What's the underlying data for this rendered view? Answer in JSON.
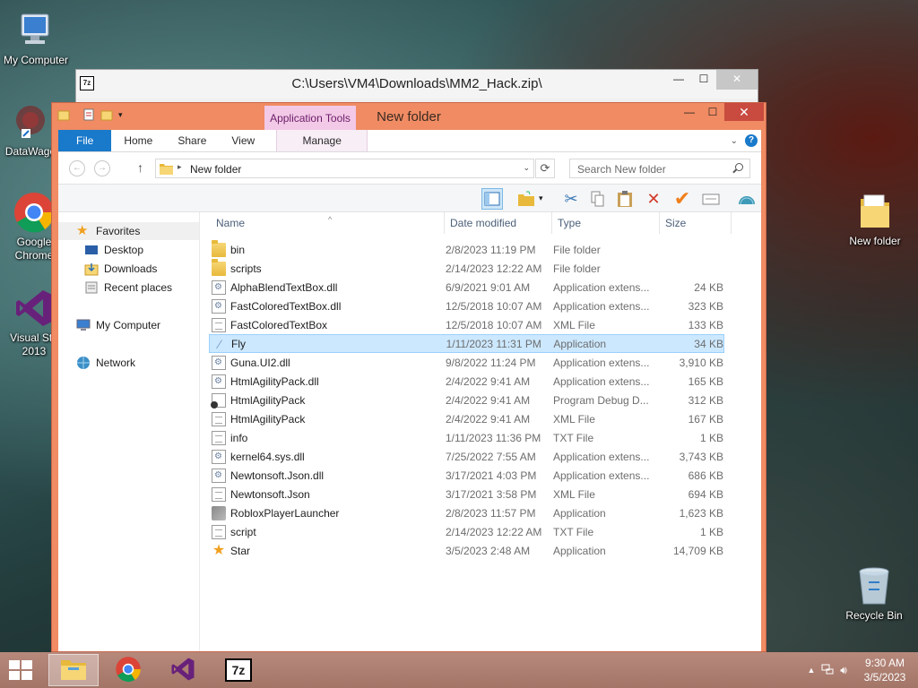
{
  "desktop": {
    "icons": [
      {
        "label": "My Computer"
      },
      {
        "label": "DataWago"
      },
      {
        "label_1": "Google",
        "label_2": "Chrome"
      },
      {
        "label_1": "Visual Stu",
        "label_2": "2013"
      },
      {
        "label": "New folder"
      },
      {
        "label": "Recycle Bin"
      }
    ]
  },
  "zip_window": {
    "title": "C:\\Users\\VM4\\Downloads\\MM2_Hack.zip\\",
    "app_icon": "7z",
    "controls": {
      "minimize": "—",
      "maximize": "☐",
      "close": "✕"
    }
  },
  "explorer": {
    "title": "New folder",
    "contextual_tab_group": "Application Tools",
    "controls": {
      "minimize": "—",
      "maximize": "☐",
      "close": "✕"
    },
    "ribbon_tabs": [
      "File",
      "Home",
      "Share",
      "View",
      "Manage"
    ],
    "address": {
      "path": "New folder"
    },
    "search": {
      "placeholder": "Search New folder"
    },
    "sidebar": {
      "favorites": "Favorites",
      "desktop": "Desktop",
      "downloads": "Downloads",
      "recent": "Recent places",
      "computer": "My Computer",
      "network": "Network"
    },
    "columns": {
      "name": "Name",
      "date": "Date modified",
      "type": "Type",
      "size": "Size"
    },
    "files": [
      {
        "name": "bin",
        "date": "2/8/2023 11:19 PM",
        "type": "File folder",
        "size": "",
        "icon": "folder-icon"
      },
      {
        "name": "scripts",
        "date": "2/14/2023 12:22 AM",
        "type": "File folder",
        "size": "",
        "icon": "folder-icon"
      },
      {
        "name": "AlphaBlendTextBox.dll",
        "date": "6/9/2021 9:01 AM",
        "type": "Application extens...",
        "size": "24 KB",
        "icon": "dll-icon"
      },
      {
        "name": "FastColoredTextBox.dll",
        "date": "12/5/2018 10:07 AM",
        "type": "Application extens...",
        "size": "323 KB",
        "icon": "dll-icon"
      },
      {
        "name": "FastColoredTextBox",
        "date": "12/5/2018 10:07 AM",
        "type": "XML File",
        "size": "133 KB",
        "icon": "document-icon"
      },
      {
        "name": "Fly",
        "date": "1/11/2023 11:31 PM",
        "type": "Application",
        "size": "34 KB",
        "icon": "feather-icon"
      },
      {
        "name": "Guna.UI2.dll",
        "date": "9/8/2022 11:24 PM",
        "type": "Application extens...",
        "size": "3,910 KB",
        "icon": "dll-icon"
      },
      {
        "name": "HtmlAgilityPack.dll",
        "date": "2/4/2022 9:41 AM",
        "type": "Application extens...",
        "size": "165 KB",
        "icon": "dll-icon"
      },
      {
        "name": "HtmlAgilityPack",
        "date": "2/4/2022 9:41 AM",
        "type": "Program Debug D...",
        "size": "312 KB",
        "icon": "debug-file-icon"
      },
      {
        "name": "HtmlAgilityPack",
        "date": "2/4/2022 9:41 AM",
        "type": "XML File",
        "size": "167 KB",
        "icon": "document-icon"
      },
      {
        "name": "info",
        "date": "1/11/2023 11:36 PM",
        "type": "TXT File",
        "size": "1 KB",
        "icon": "document-icon"
      },
      {
        "name": "kernel64.sys.dll",
        "date": "7/25/2022 7:55 AM",
        "type": "Application extens...",
        "size": "3,743 KB",
        "icon": "dll-icon"
      },
      {
        "name": "Newtonsoft.Json.dll",
        "date": "3/17/2021 4:03 PM",
        "type": "Application extens...",
        "size": "686 KB",
        "icon": "dll-icon"
      },
      {
        "name": "Newtonsoft.Json",
        "date": "3/17/2021 3:58 PM",
        "type": "XML File",
        "size": "694 KB",
        "icon": "document-icon"
      },
      {
        "name": "RobloxPlayerLauncher",
        "date": "2/8/2023 11:57 PM",
        "type": "Application",
        "size": "1,623 KB",
        "icon": "roblox-icon"
      },
      {
        "name": "script",
        "date": "2/14/2023 12:22 AM",
        "type": "TXT File",
        "size": "1 KB",
        "icon": "document-icon"
      },
      {
        "name": "Star",
        "date": "3/5/2023 2:48 AM",
        "type": "Application",
        "size": "14,709 KB",
        "icon": "star-icon"
      }
    ],
    "selected_file": "Fly"
  },
  "taskbar": {
    "time": "9:30 AM",
    "date": "3/5/2023",
    "apps": [
      "file-explorer-icon",
      "chrome-icon",
      "visual-studio-icon",
      "7zip-icon"
    ],
    "zip_label": "7z"
  },
  "colors": {
    "window_frame": "#f08b63",
    "ribbon_file_tab": "#1979ca",
    "selection": "#cce8ff",
    "app_tools": "#f2c9e6"
  }
}
